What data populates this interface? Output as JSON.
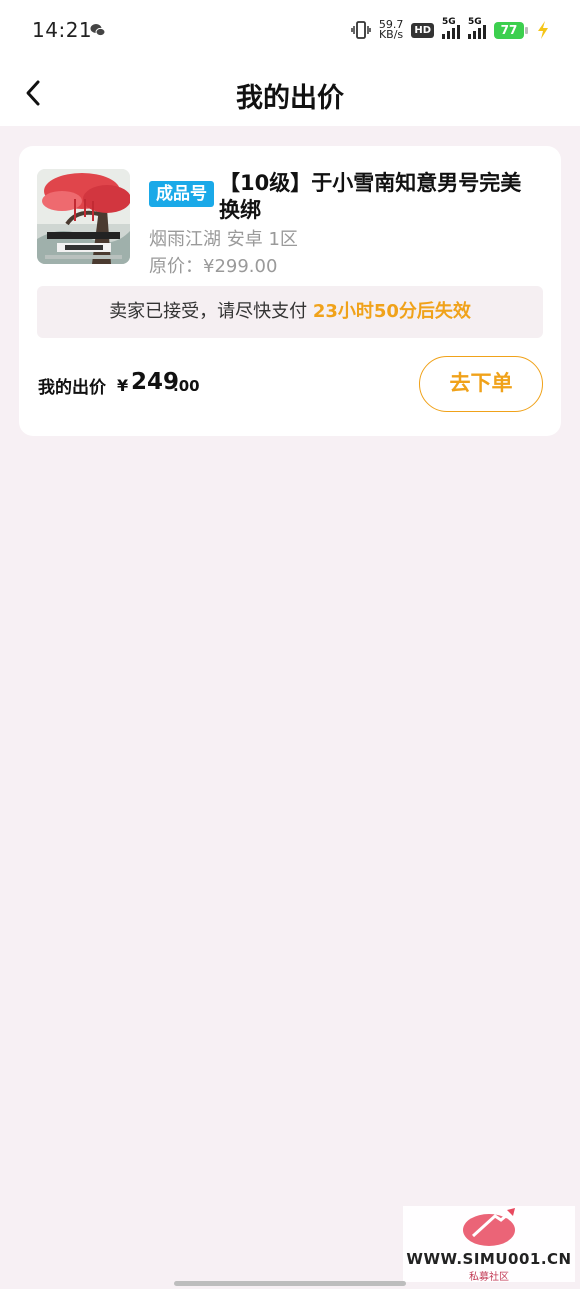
{
  "status_bar": {
    "time": "14:21",
    "net_speed_value": "59.7",
    "net_speed_unit": "KB/s",
    "hd_label": "HD",
    "signal_1_label": "5G",
    "signal_2_label": "5G",
    "battery_level": "77"
  },
  "nav": {
    "title": "我的出价",
    "back_icon": "chevron-left-icon"
  },
  "offer": {
    "tag": "成品号",
    "title": "【10级】于小雪南知意男号完美换绑",
    "server": "烟雨江湖 安卓 1区",
    "original_price": "原价：¥299.00",
    "notice_prefix": "卖家已接受，请尽快支付",
    "notice_countdown": "23小时50分后失效",
    "my_offer_label": "我的出价",
    "currency": "¥",
    "offer_integer": "249",
    "offer_decimal": ".00",
    "order_button_label": "去下单"
  },
  "watermark": {
    "url": "WWW.SIMU001.CN",
    "subtitle": "私募社区"
  },
  "colors": {
    "accent": "#f0a21a",
    "tag_blue": "#1aa9e8",
    "page_bg": "#f7f0f4",
    "battery_green": "#3ccf4e"
  }
}
